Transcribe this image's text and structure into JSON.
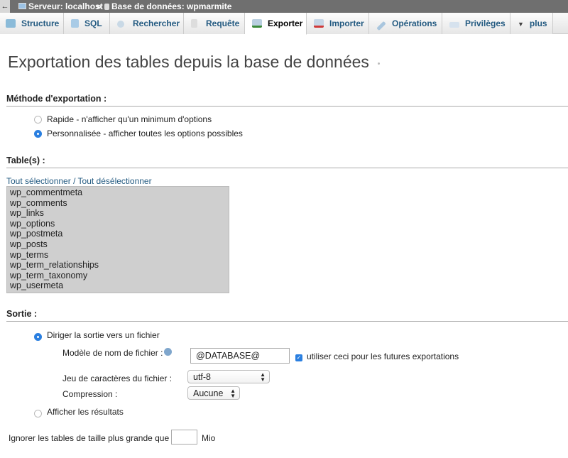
{
  "breadcrumb": {
    "back": "←",
    "server": "Serveur: localhost",
    "sep": "»",
    "database": "Base de données: wpmarmite"
  },
  "tabs": [
    {
      "label": "Structure",
      "icon": "structure-icon"
    },
    {
      "label": "SQL",
      "icon": "sql-icon"
    },
    {
      "label": "Rechercher",
      "icon": "search-icon"
    },
    {
      "label": "Requête",
      "icon": "query-icon"
    },
    {
      "label": "Exporter",
      "icon": "export-icon",
      "active": true
    },
    {
      "label": "Importer",
      "icon": "import-icon"
    },
    {
      "label": "Opérations",
      "icon": "wrench-icon"
    },
    {
      "label": "Privilèges",
      "icon": "privileges-icon"
    },
    {
      "label": "plus",
      "icon": "caret-down-icon"
    }
  ],
  "title": "Exportation des tables depuis la base de données",
  "method": {
    "heading": "Méthode d'exportation :",
    "options": [
      "Rapide - n'afficher qu'un minimum d'options",
      "Personnalisée - afficher toutes les options possibles"
    ],
    "selected": 1
  },
  "tables": {
    "heading": "Table(s) :",
    "select_all": "Tout sélectionner",
    "sep": " / ",
    "deselect_all": "Tout désélectionner",
    "items": [
      "wp_commentmeta",
      "wp_comments",
      "wp_links",
      "wp_options",
      "wp_postmeta",
      "wp_posts",
      "wp_terms",
      "wp_term_relationships",
      "wp_term_taxonomy",
      "wp_usermeta"
    ]
  },
  "output": {
    "heading": "Sortie :",
    "to_file": "Diriger la sortie vers un fichier",
    "filename_label": "Modèle de nom de fichier :",
    "filename_value": "@DATABASE@",
    "remember_label": "utiliser ceci pour les futures exportations",
    "remember_checked": true,
    "charset_label": "Jeu de caractères du fichier :",
    "charset_value": "utf-8",
    "compression_label": "Compression :",
    "compression_value": "Aucune",
    "show_results": "Afficher les résultats",
    "selected": 0
  },
  "skip": {
    "label": "Ignorer les tables de taille plus grande que",
    "value": "",
    "unit": "Mio"
  },
  "colors": {
    "accent": "#2a7fe0",
    "link": "#235a81",
    "topbar": "#6f6f6f"
  }
}
